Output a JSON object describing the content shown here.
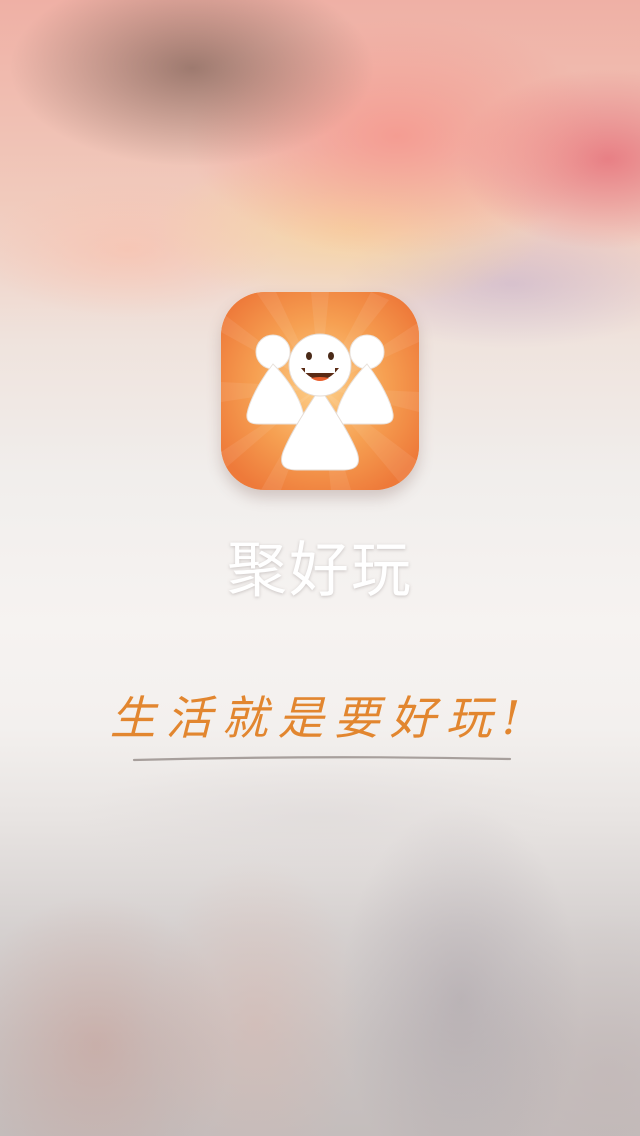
{
  "app": {
    "name": "聚好玩",
    "slogan": "生活就是要好玩!"
  },
  "icons": {
    "logo": "smiling-mascot-app-icon"
  },
  "colors": {
    "icon_orange": "#f0823f",
    "icon_light": "#fbc07a",
    "slogan": "#e2862f",
    "title": "#ffffff"
  }
}
